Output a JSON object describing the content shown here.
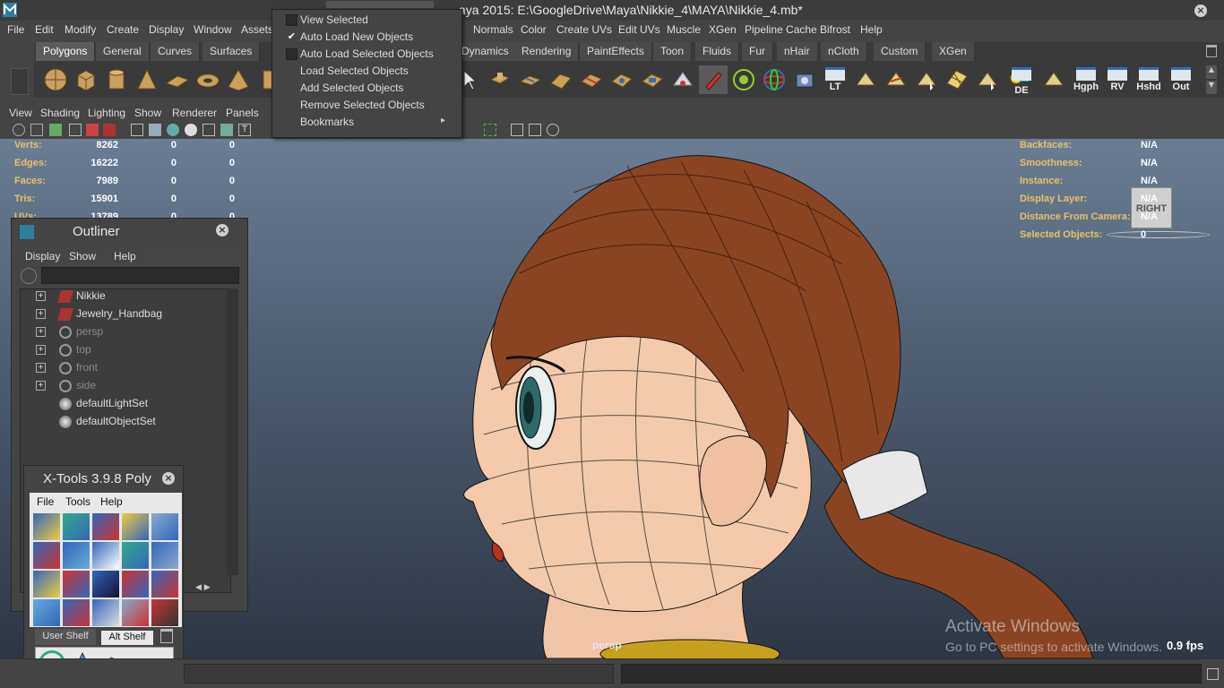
{
  "window": {
    "title": "aya 2015: E:\\GoogleDrive\\Maya\\Nikkie_4\\MAYA\\Nikkie_4.mb*"
  },
  "menubar": {
    "items": [
      "File",
      "Edit",
      "Modify",
      "Create",
      "Display",
      "Window",
      "Assets",
      "Normals",
      "Color",
      "Create UVs",
      "Edit UVs",
      "Muscle",
      "XGen",
      "Pipeline Cache",
      "Bifrost",
      "Help"
    ]
  },
  "shelf_tabs": [
    "Polygons",
    "General",
    "Curves",
    "Surfaces",
    "Dynamics",
    "Rendering",
    "PaintEffects",
    "Toon",
    "Fluids",
    "Fur",
    "nHair",
    "nCloth",
    "Custom",
    "XGen"
  ],
  "shelf": {
    "text_buttons": [
      "LT",
      "DE",
      "Hgph",
      "RV",
      "Hshd",
      "Out"
    ]
  },
  "panel_menu": [
    "View",
    "Shading",
    "Lighting",
    "Show",
    "Renderer",
    "Panels"
  ],
  "isolate_menu": {
    "items": [
      {
        "label": "View Selected",
        "checked": false
      },
      {
        "label": "Auto Load New Objects",
        "checked": true
      },
      {
        "label": "Auto Load Selected Objects",
        "checked": false
      },
      {
        "label": "Load Selected Objects"
      },
      {
        "label": "Add Selected Objects"
      },
      {
        "label": "Remove Selected Objects"
      },
      {
        "label": "Bookmarks",
        "submenu": true
      }
    ],
    "check_mark": "✔",
    "submenu_arrow": "▸"
  },
  "hud_left": [
    {
      "label": "Verts:",
      "v1": "8262",
      "v2": "0",
      "v3": "0"
    },
    {
      "label": "Edges:",
      "v1": "16222",
      "v2": "0",
      "v3": "0"
    },
    {
      "label": "Faces:",
      "v1": "7989",
      "v2": "0",
      "v3": "0"
    },
    {
      "label": "Tris:",
      "v1": "15901",
      "v2": "0",
      "v3": "0"
    },
    {
      "label": "UVs:",
      "v1": "13789",
      "v2": "0",
      "v3": "0"
    }
  ],
  "hud_right": [
    {
      "label": "Backfaces:",
      "value": "N/A"
    },
    {
      "label": "Smoothness:",
      "value": "N/A"
    },
    {
      "label": "Instance:",
      "value": "N/A"
    },
    {
      "label": "Display Layer:",
      "value": "N/A"
    },
    {
      "label": "Distance From Camera:",
      "value": "N/A"
    },
    {
      "label": "Selected Objects:",
      "value": "0"
    }
  ],
  "viewcube_label": "RIGHT",
  "camera_label": "persp",
  "fps": "0.9 fps",
  "watermark": {
    "line1": "Activate Windows",
    "line2": "Go to PC settings to activate Windows."
  },
  "outliner": {
    "title": "Outliner",
    "menu": [
      "Display",
      "Show",
      "Help"
    ],
    "items": [
      {
        "label": "Nikkie",
        "expandable": true,
        "icon": "mesh-icon",
        "dim": false
      },
      {
        "label": "Jewelry_Handbag",
        "expandable": true,
        "icon": "mesh-icon",
        "dim": false
      },
      {
        "label": "persp",
        "expandable": true,
        "icon": "camera-icon",
        "dim": true
      },
      {
        "label": "top",
        "expandable": true,
        "icon": "camera-icon",
        "dim": true
      },
      {
        "label": "front",
        "expandable": true,
        "icon": "camera-icon",
        "dim": true
      },
      {
        "label": "side",
        "expandable": true,
        "icon": "camera-icon",
        "dim": true
      },
      {
        "label": "defaultLightSet",
        "expandable": false,
        "icon": "set-icon",
        "dim": false
      },
      {
        "label": "defaultObjectSet",
        "expandable": false,
        "icon": "set-icon",
        "dim": false
      }
    ]
  },
  "xtools": {
    "title": "X-Tools 3.9.8 Poly",
    "menu": [
      "File",
      "Tools",
      "Help"
    ],
    "tabs": [
      "User Shelf",
      "Alt Shelf"
    ]
  },
  "colors": {
    "hud_label": "#e8c06a",
    "hair": "#8a4422",
    "skin": "#f2c6a8",
    "accent": "#3a6ab4"
  }
}
